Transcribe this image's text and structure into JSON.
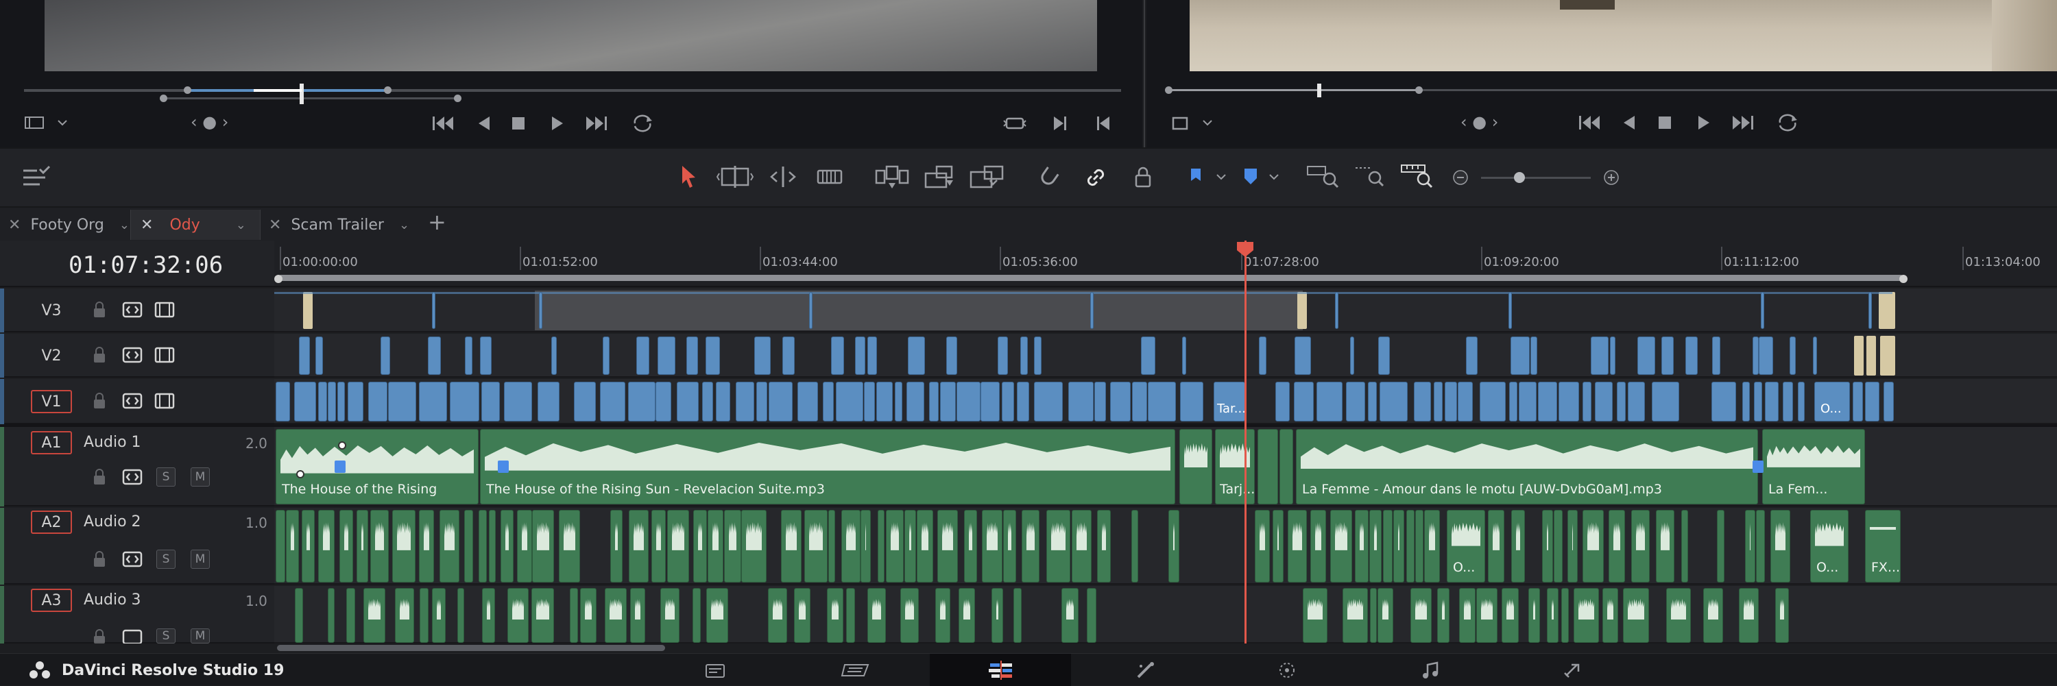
{
  "app": {
    "name": "DaVinci Resolve Studio 19"
  },
  "source_viewer": {
    "clip_dots": "‹ ● ›"
  },
  "timeline_viewer": {
    "clip_dots": "‹ ● ›"
  },
  "tabs": [
    {
      "label": "Footy Org",
      "active": false
    },
    {
      "label": "Ody",
      "active": true
    },
    {
      "label": "Scam Trailer",
      "active": false
    }
  ],
  "timeline": {
    "timecode": "01:07:32:06",
    "ruler": [
      "01:00:00:00",
      "01:01:52:00",
      "01:03:44:00",
      "01:05:36:00",
      "01:07:28:00",
      "01:09:20:00",
      "01:11:12:00",
      "01:13:04:00"
    ]
  },
  "tracks": {
    "video": [
      {
        "id": "V3"
      },
      {
        "id": "V2"
      },
      {
        "id": "V1"
      }
    ],
    "audio": [
      {
        "id": "A1",
        "name": "Audio 1",
        "level": "2.0"
      },
      {
        "id": "A2",
        "name": "Audio 2",
        "level": "1.0"
      },
      {
        "id": "A3",
        "name": "Audio 3",
        "level": "1.0"
      }
    ],
    "solo_label": "S",
    "mute_label": "M"
  },
  "clips": {
    "v1_tar": "Tar...",
    "v1_o": "O...",
    "a1": [
      "The House of the Rising ...",
      "The House of the Rising Sun - Revelacion Suite.mp3",
      "Tarj...",
      "La Femme - Amour dans le motu [AUW-DvbG0aM].mp3",
      "La Fem..."
    ],
    "a2": [
      "O...",
      "O...",
      "FX..."
    ]
  },
  "bottom_nav": [
    {
      "icon": "media-page-icon",
      "active": false
    },
    {
      "icon": "cut-page-icon",
      "active": false
    },
    {
      "icon": "edit-page-icon",
      "active": true
    },
    {
      "icon": "fusion-page-icon",
      "active": false
    },
    {
      "icon": "color-page-icon",
      "active": false
    },
    {
      "icon": "fairlight-page-icon",
      "active": false
    },
    {
      "icon": "deliver-page-icon",
      "active": false
    }
  ],
  "colors": {
    "playhead": "#e2584b",
    "video_clip": "#5b8ec1",
    "audio_clip": "#3f7c54",
    "track_id_border": "#c9463d"
  }
}
